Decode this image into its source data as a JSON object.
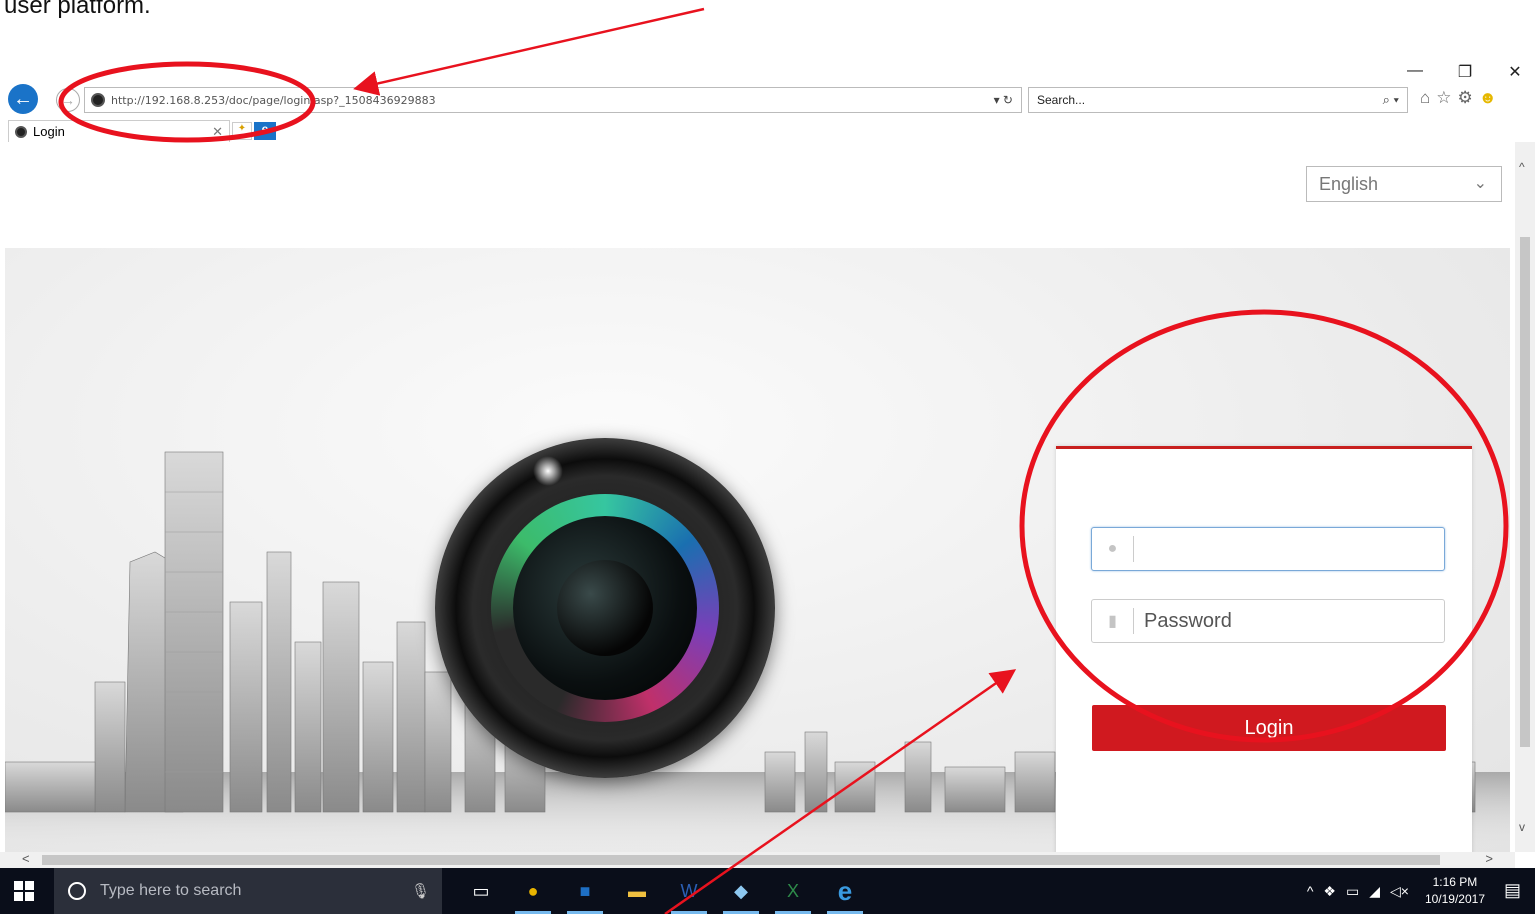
{
  "caption": "user platform.",
  "browser": {
    "url_host": "http://192.168.8.253",
    "url_path": "/doc/page/login.asp?_1508436929883",
    "search_placeholder": "Search...",
    "tab_title": "Login"
  },
  "page": {
    "language": "English",
    "password_placeholder": "Password",
    "login_label": "Login",
    "accent_color": "#d0191f"
  },
  "taskbar": {
    "search_placeholder": "Type here to search",
    "time": "1:16 PM",
    "date": "10/19/2017"
  }
}
